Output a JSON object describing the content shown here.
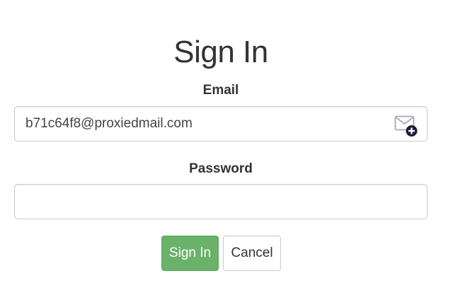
{
  "form": {
    "title": "Sign In",
    "email_label": "Email",
    "email_value": "b71c64f8@proxiedmail.com",
    "password_label": "Password",
    "password_value": "",
    "signin_label": "Sign In",
    "cancel_label": "Cancel"
  },
  "icons": {
    "email_field": "mail-plus-icon"
  },
  "colors": {
    "primary_button": "#6ab26a",
    "text": "#333333",
    "border": "#c9c9c9",
    "icon_badge": "#1e1b3a"
  }
}
